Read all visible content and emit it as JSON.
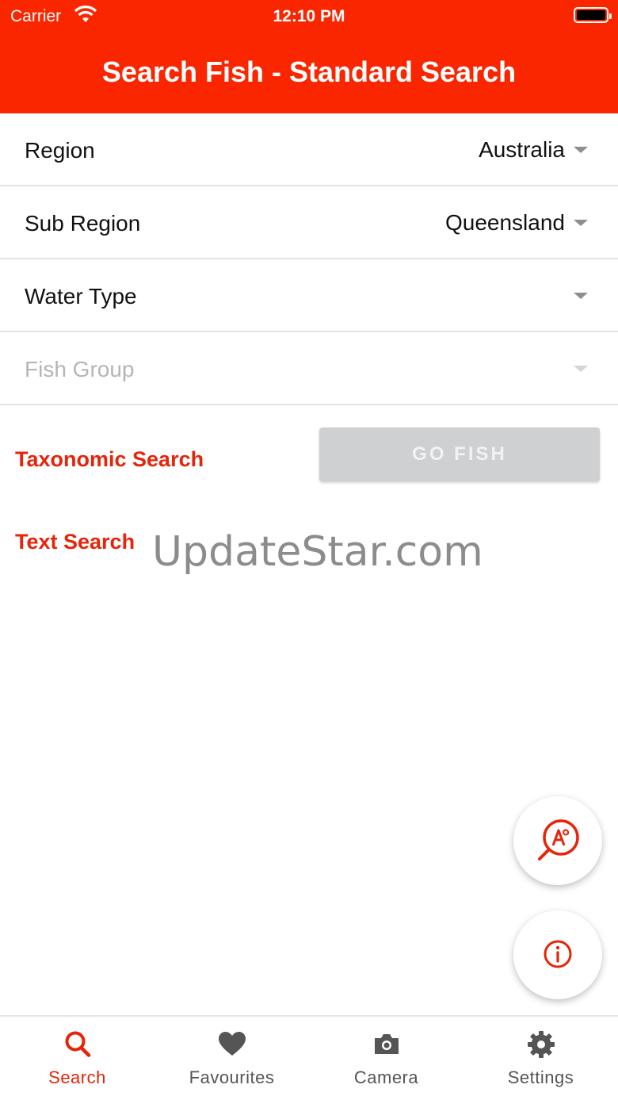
{
  "status_bar": {
    "carrier": "Carrier",
    "time": "12:10 PM"
  },
  "header": {
    "title": "Search Fish - Standard Search"
  },
  "filters": [
    {
      "label": "Region",
      "value": "Australia"
    },
    {
      "label": "Sub Region",
      "value": "Queensland"
    },
    {
      "label": "Water Type",
      "value": ""
    },
    {
      "label": "Fish Group",
      "value": ""
    }
  ],
  "links": {
    "taxonomic": "Taxonomic Search",
    "text": "Text Search"
  },
  "go_fish_button": "GO FISH",
  "watermark": "UpdateStar.com",
  "tabs": [
    {
      "label": "Search",
      "icon": "search-icon"
    },
    {
      "label": "Favourites",
      "icon": "heart-icon"
    },
    {
      "label": "Camera",
      "icon": "camera-icon"
    },
    {
      "label": "Settings",
      "icon": "gear-icon"
    }
  ],
  "colors": {
    "accent": "#fa2600",
    "link": "#e6240a",
    "button_disabled": "#cfd0d2"
  }
}
